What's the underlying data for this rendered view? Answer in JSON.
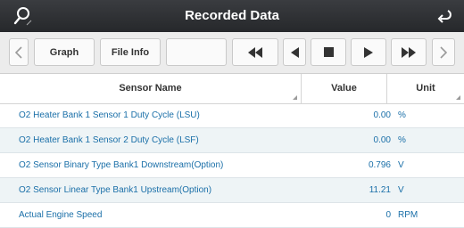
{
  "window": {
    "title": "Recorded Data"
  },
  "toolbar": {
    "graph_label": "Graph",
    "file_info_label": "File Info",
    "empty_label": ""
  },
  "table": {
    "headers": {
      "name": "Sensor Name",
      "value": "Value",
      "unit": "Unit"
    },
    "rows": [
      {
        "name": "O2 Heater Bank 1 Sensor 1 Duty Cycle (LSU)",
        "value": "0.00",
        "unit": "%"
      },
      {
        "name": "O2 Heater Bank 1 Sensor 2 Duty Cycle (LSF)",
        "value": "0.00",
        "unit": "%"
      },
      {
        "name": "O2 Sensor Binary Type Bank1 Downstream(Option)",
        "value": "0.796",
        "unit": "V"
      },
      {
        "name": "O2 Sensor Linear Type Bank1 Upstream(Option)",
        "value": "11.21",
        "unit": "V"
      },
      {
        "name": "Actual Engine Speed",
        "value": "0",
        "unit": "RPM"
      }
    ]
  },
  "colors": {
    "titlebar": "#2e3033",
    "row_text": "#1a6fa8",
    "row_alt": "#eef4f6"
  },
  "icons": [
    "search-icon",
    "back-icon",
    "prev-arrow-icon",
    "rewind-icon",
    "step-back-icon",
    "stop-icon",
    "play-icon",
    "fast-forward-icon",
    "next-arrow-icon"
  ]
}
